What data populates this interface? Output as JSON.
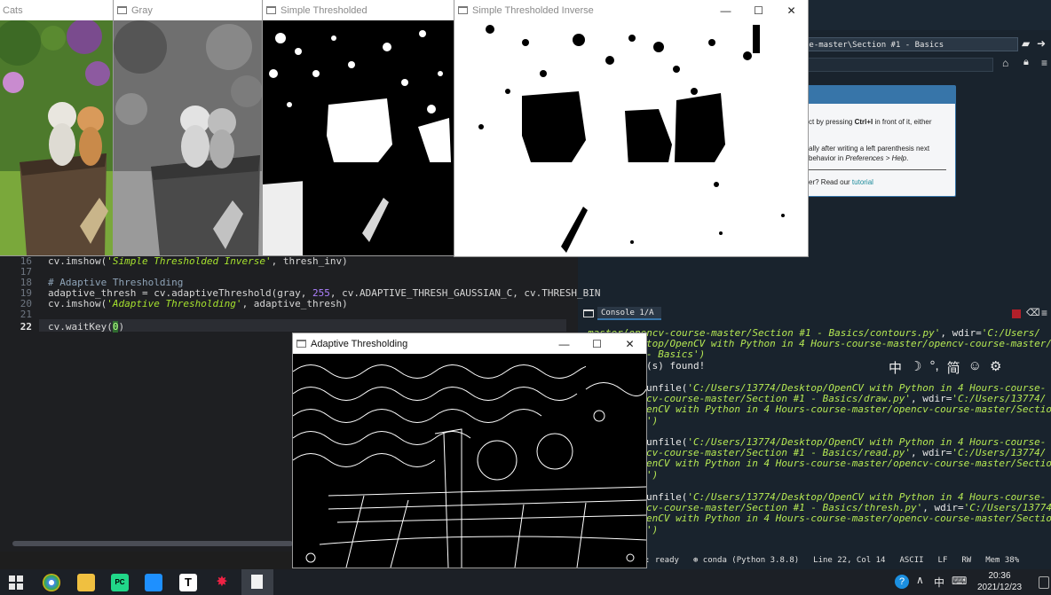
{
  "windows": {
    "cats": {
      "title": "Cats"
    },
    "gray": {
      "title": "Gray"
    },
    "simple": {
      "title": "Simple Thresholded"
    },
    "inverse": {
      "title": "Simple Thresholded Inverse"
    },
    "adaptive": {
      "title": "Adaptive Thresholding"
    }
  },
  "window_controls": {
    "minimize": "—",
    "maximize": "☐",
    "close": "✕"
  },
  "ide": {
    "path_field": "se-master\\Section #1 - Basics",
    "help_tip": {
      "line1": "ct by pressing ",
      "line1_key": "Ctrl+I",
      "line1_end": " in front of it, either",
      "line2": "ally after writing a left parenthesis next",
      "line3a": "behavior in ",
      "line3b": "Preferences > Help",
      "line3c": ".",
      "line4": "er? Read our ",
      "line4_link": "tutorial"
    }
  },
  "editor": {
    "lines": [
      {
        "num": "16",
        "parts": [
          "cv.imshow(",
          "'Simple Thresholded Inverse'",
          ", thresh_inv)"
        ]
      },
      {
        "num": "17",
        "parts": [
          "",
          "",
          ""
        ]
      },
      {
        "num": "18",
        "parts": [
          "# Adaptive Thresholding",
          "",
          ""
        ]
      },
      {
        "num": "19",
        "parts": [
          "adaptive_thresh = cv.adaptiveThreshold(gray, ",
          "255",
          ", cv.ADAPTIVE_THRESH_GAUSSIAN_C, cv.THRESH_BIN"
        ]
      },
      {
        "num": "20",
        "parts": [
          "cv.imshow(",
          "'Adaptive Thresholding'",
          ", adaptive_thresh)"
        ]
      },
      {
        "num": "21",
        "parts": [
          "",
          "",
          ""
        ]
      },
      {
        "num": "22",
        "parts": [
          "cv.waitKey(",
          "0",
          ")"
        ]
      }
    ]
  },
  "console": {
    "tab_label": "Console 1/A",
    "lines": [
      {
        "a": "master/opencv-course-master/Section #1 - Basics/contours.py'",
        "b": ", wdir=",
        "c": "'C:/Users/"
      },
      {
        "a": "top/OpenCV with Python in 4 Hours-course-master/opencv-course-master/",
        "b": "",
        "c": ""
      },
      {
        "a": "- Basics')",
        "b": "",
        "c": ""
      },
      {
        "a": "(s) found!",
        "b": "",
        "c": ""
      },
      {
        "a": "unfile(",
        "b": "'C:/Users/13774/Desktop/OpenCV with Python in 4 Hours-course-",
        "c": ""
      },
      {
        "a": "cv-course-master/Section #1 - Basics/draw.py'",
        "b": ", wdir=",
        "c": "'C:/Users/13774/"
      },
      {
        "a": "enCV with Python in 4 Hours-course-master/opencv-course-master/Section",
        "b": "",
        "c": ""
      },
      {
        "a": "')",
        "b": "",
        "c": ""
      },
      {
        "a": "unfile(",
        "b": "'C:/Users/13774/Desktop/OpenCV with Python in 4 Hours-course-",
        "c": ""
      },
      {
        "a": "cv-course-master/Section #1 - Basics/read.py'",
        "b": ", wdir=",
        "c": "'C:/Users/13774/"
      },
      {
        "a": "enCV with Python in 4 Hours-course-master/opencv-course-master/Section",
        "b": "",
        "c": ""
      },
      {
        "a": "')",
        "b": "",
        "c": ""
      },
      {
        "a": "unfile(",
        "b": "'C:/Users/13774/Desktop/OpenCV with Python in 4 Hours-course-",
        "c": ""
      },
      {
        "a": "cv-course-master/Section #1 - Basics/thresh.py'",
        "b": ", wdir=",
        "c": "'C:/Users/13774/"
      },
      {
        "a": "enCV with Python in 4 Hours-course-master/opencv-course-master/Section",
        "b": "",
        "c": ""
      },
      {
        "a": "')",
        "b": "",
        "c": ""
      }
    ]
  },
  "ime": {
    "lang": "中",
    "moon": "☽",
    "punct": "°,",
    "simplified": "简",
    "emoji": "☺",
    "gear": "⚙"
  },
  "status": {
    "state": ": ready",
    "env": "conda (Python 3.8.8)",
    "cursor": "Line 22, Col 14",
    "encoding": "ASCII",
    "eol": "LF",
    "perm": "RW",
    "mem": "Mem 38%"
  },
  "taskbar": {
    "time": "20:36",
    "date": "2021/12/23",
    "ime_lang": "中",
    "kbd": "⌨"
  },
  "colors": {
    "accent": "#3775a9",
    "console_bg": "#19232d",
    "editor_bg": "#1e1f22",
    "string": "#a6e22e"
  }
}
